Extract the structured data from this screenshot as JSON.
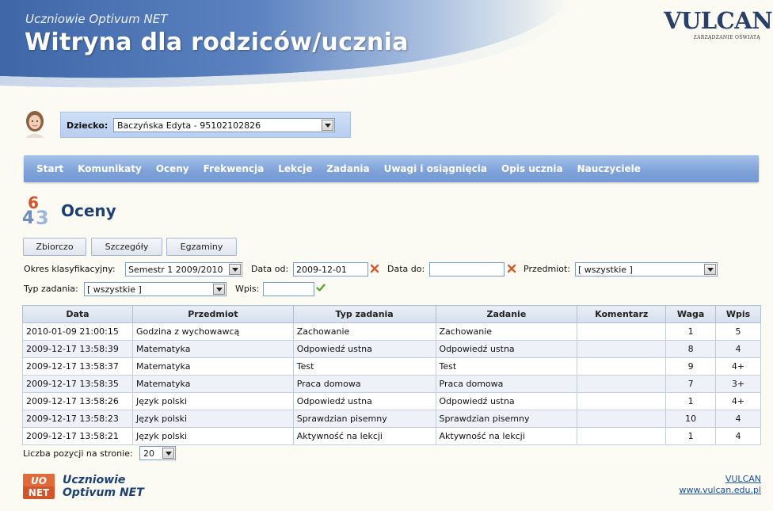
{
  "header": {
    "subtitle": "Uczniowie Optivum NET",
    "title": "Witryna dla rodziców/ucznia",
    "logo_word": "VULCAN",
    "logo_tagline": "ZARZĄDZANIE OŚWIATĄ"
  },
  "child": {
    "label": "Dziecko:",
    "selected": "Baczyńska Edyta - 95102102826"
  },
  "nav": [
    "Start",
    "Komunikaty",
    "Oceny",
    "Frekwencja",
    "Lekcje",
    "Zadania",
    "Uwagi i osiągnięcia",
    "Opis ucznia",
    "Nauczyciele"
  ],
  "section": {
    "title": "Oceny",
    "icon": "grades-icon"
  },
  "tabs": [
    "Zbiorczo",
    "Szczegóły",
    "Egzaminy"
  ],
  "filters": {
    "period_label": "Okres klasyfikacyjny:",
    "period_value": "Semestr 1 2009/2010",
    "date_from_label": "Data od:",
    "date_from_value": "2009-12-01",
    "date_to_label": "Data do:",
    "date_to_value": "",
    "subject_label": "Przedmiot:",
    "subject_value": "[ wszystkie ]",
    "task_type_label": "Typ zadania:",
    "task_type_value": "[ wszystkie ]",
    "entry_label": "Wpis:",
    "entry_value": ""
  },
  "table": {
    "headers": [
      "Data",
      "Przedmiot",
      "Typ zadania",
      "Zadanie",
      "Komentarz",
      "Waga",
      "Wpis"
    ],
    "rows": [
      [
        "2010-01-09 21:00:15",
        "Godzina z wychowawcą",
        "Zachowanie",
        "Zachowanie",
        "",
        "1",
        "5"
      ],
      [
        "2009-12-17 13:58:39",
        "Matematyka",
        "Odpowiedź ustna",
        "Odpowiedź ustna",
        "",
        "8",
        "4"
      ],
      [
        "2009-12-17 13:58:37",
        "Matematyka",
        "Test",
        "Test",
        "",
        "9",
        "4+"
      ],
      [
        "2009-12-17 13:58:35",
        "Matematyka",
        "Praca domowa",
        "Praca domowa",
        "",
        "7",
        "3+"
      ],
      [
        "2009-12-17 13:58:26",
        "Język polski",
        "Odpowiedź ustna",
        "Odpowiedź ustna",
        "",
        "1",
        "4+"
      ],
      [
        "2009-12-17 13:58:23",
        "Język polski",
        "Sprawdzian pisemny",
        "Sprawdzian pisemny",
        "",
        "10",
        "4"
      ],
      [
        "2009-12-17 13:58:21",
        "Język polski",
        "Aktywność na lekcji",
        "Aktywność na lekcji",
        "",
        "1",
        "4"
      ]
    ]
  },
  "pager": {
    "label": "Liczba pozycji na stronie:",
    "value": "20"
  },
  "footer": {
    "logo_top": "UO",
    "logo_bottom": "NET",
    "brand_line1": "Uczniowie",
    "brand_line2": "Optivum NET",
    "link1": "VULCAN",
    "link2": "www.vulcan.edu.pl"
  }
}
